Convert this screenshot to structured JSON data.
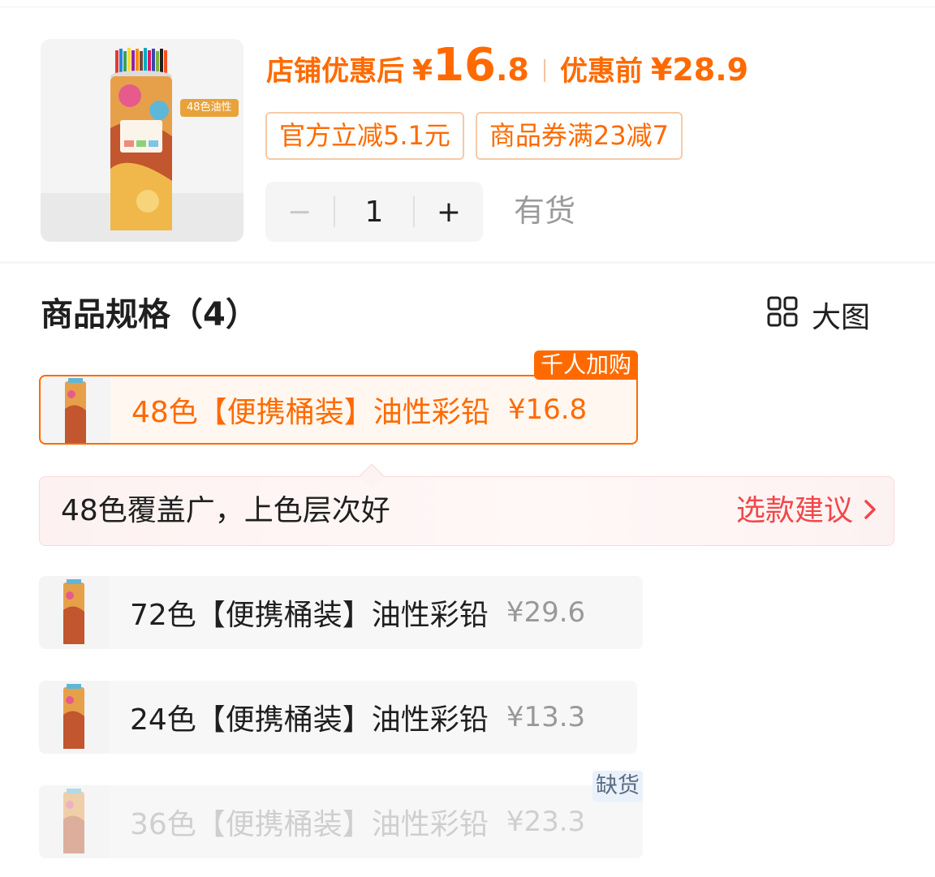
{
  "product": {
    "image_tag": "48色油性",
    "price_after_label": "店铺优惠后",
    "currency": "¥",
    "price_after_int": "16",
    "price_after_dec": ".8",
    "price_before_label": "优惠前",
    "price_before": "¥28.9",
    "coupons": [
      "官方立减5.1元",
      "商品券满23减7"
    ],
    "quantity": {
      "minus": "−",
      "value": "1",
      "plus": "+"
    },
    "stock": "有货"
  },
  "specs": {
    "title": "商品规格（4）",
    "big_picture_label": "大图",
    "items": [
      {
        "name": "48色【便携桶装】油性彩铅",
        "price": "¥16.8",
        "badge": "千人加购",
        "state": "selected"
      },
      {
        "name": "72色【便携桶装】油性彩铅",
        "price": "¥29.6",
        "state": "normal"
      },
      {
        "name": "24色【便携桶装】油性彩铅",
        "price": "¥13.3",
        "state": "normal"
      },
      {
        "name": "36色【便携桶装】油性彩铅",
        "price": "¥23.3",
        "badge": "缺货",
        "state": "soldout"
      }
    ],
    "tip": {
      "text": "48色覆盖广，上色层次好",
      "link": "选款建议"
    }
  },
  "colors": {
    "accent": "#ff6a00",
    "tip_link": "#f2474a"
  }
}
